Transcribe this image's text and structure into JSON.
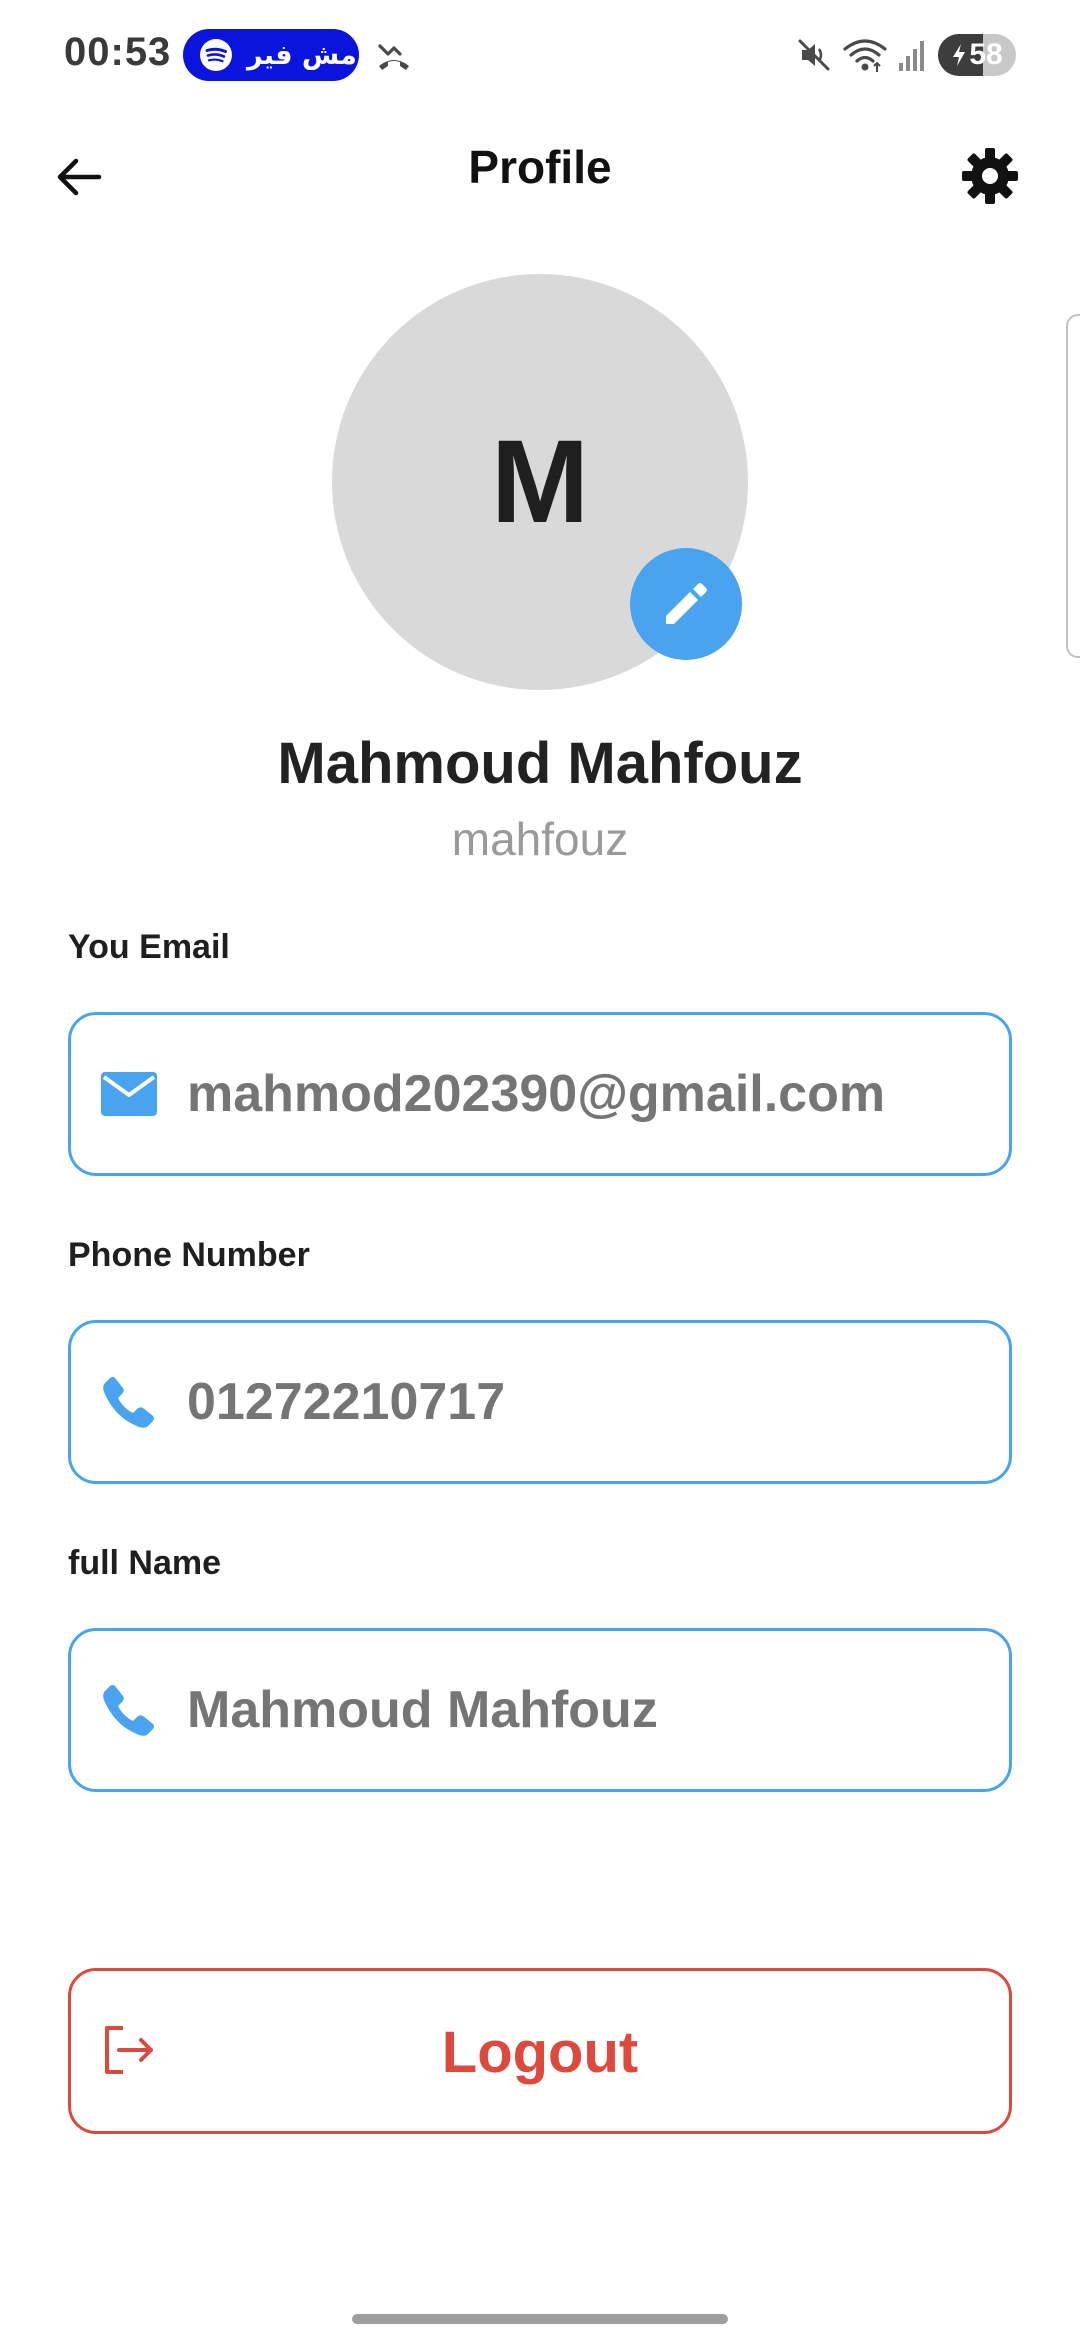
{
  "status_bar": {
    "time": "00:53",
    "spotify_notification": "مش فير",
    "battery_level": "58",
    "battery_fraction": 0.58,
    "icons": [
      "spotify-icon",
      "missed-call-icon",
      "mute-icon",
      "wifi-icon",
      "signal-icon",
      "battery-charging-icon"
    ]
  },
  "app_bar": {
    "title": "Profile",
    "back_icon": "arrow-back-icon",
    "settings_icon": "gear-icon"
  },
  "profile": {
    "initial": "M",
    "name": "Mahmoud Mahfouz",
    "username": "mahfouz",
    "edit_icon": "pencil-icon"
  },
  "fields": {
    "email": {
      "label": "You Email",
      "value": "mahmod202390@gmail.com",
      "icon": "mail-icon"
    },
    "phone": {
      "label": "Phone Number",
      "value": "01272210717",
      "icon": "phone-icon"
    },
    "full_name": {
      "label": "full Name",
      "value": "Mahmoud Mahfouz",
      "icon": "phone-icon"
    }
  },
  "logout": {
    "label": "Logout",
    "icon": "logout-icon"
  },
  "colors": {
    "accent": "#4aa3ef",
    "danger": "#dc4a3d",
    "avatar_bg": "#d9d9d9",
    "spotify_pill": "#0a14dc",
    "value_text": "#757575"
  }
}
